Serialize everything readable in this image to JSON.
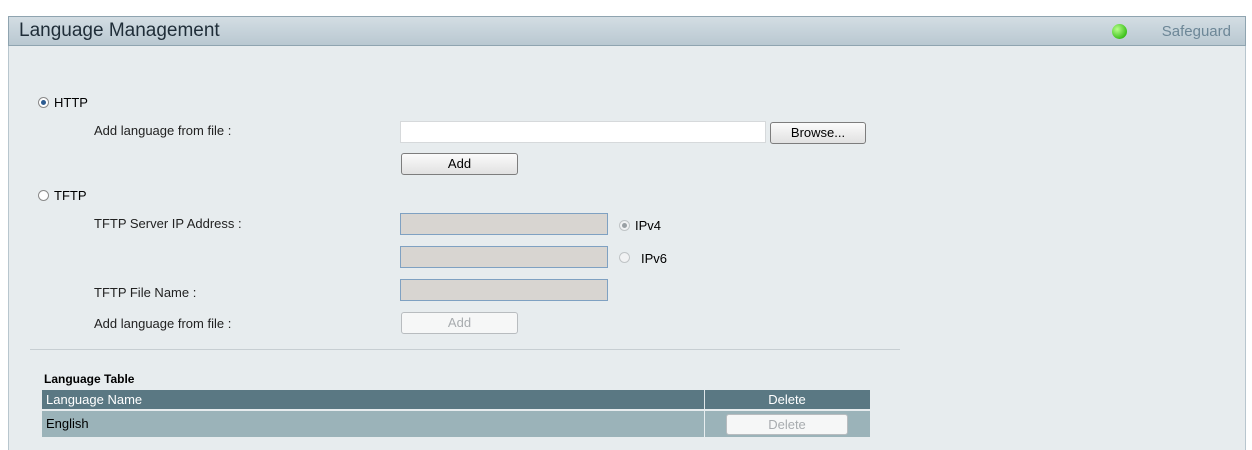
{
  "header": {
    "title": "Language Management",
    "safeguard_label": "Safeguard",
    "safeguard_color": "#3fc21d"
  },
  "http": {
    "label": "HTTP",
    "selected": true,
    "add_from_file_label": "Add language from file :",
    "file_value": "",
    "browse_label": "Browse...",
    "add_label": "Add"
  },
  "tftp": {
    "label": "TFTP",
    "selected": false,
    "server_ip_label": "TFTP Server IP Address :",
    "ipv4_value": "",
    "ipv4_label": "IPv4",
    "ipv6_value": "",
    "ipv6_label": "IPv6",
    "file_name_label": "TFTP File Name :",
    "file_name_value": "",
    "add_from_file_label": "Add language from file :",
    "add_label": "Add"
  },
  "language_table": {
    "caption": "Language Table",
    "columns": [
      "Language Name",
      "Delete"
    ],
    "rows": [
      {
        "name": "English",
        "delete_label": "Delete"
      }
    ]
  }
}
